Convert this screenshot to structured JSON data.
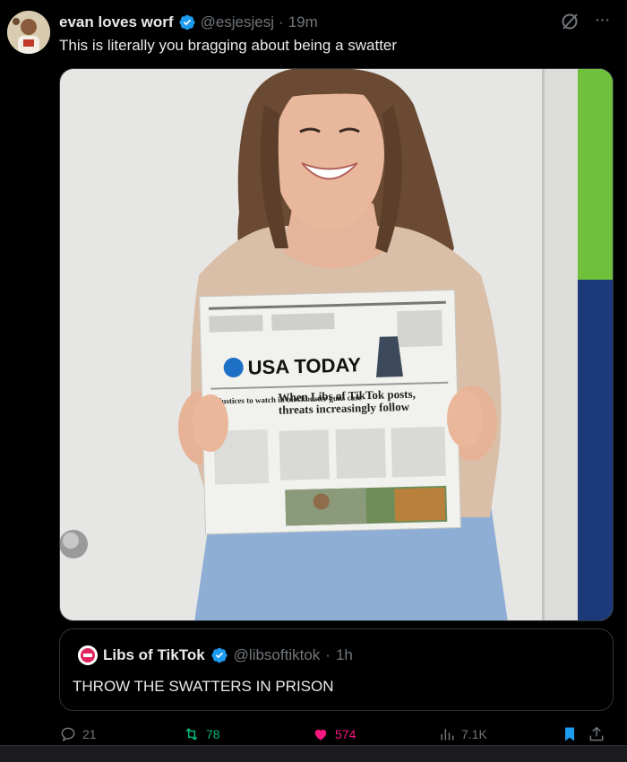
{
  "tweet": {
    "display_name": "evan loves worf",
    "handle": "@esjesjesj",
    "separator": "·",
    "time": "19m",
    "text": "This is literally you bragging about being a swatter"
  },
  "newspaper": {
    "masthead": "USA TODAY",
    "headline": "When Libs of TikTok posts, threats increasingly follow",
    "sidebar_headline": "3 justices to watch in blockbuster guns case"
  },
  "quote": {
    "display_name": "Libs of TikTok",
    "handle": "@libsoftiktok",
    "separator": "·",
    "time": "1h",
    "text": "THROW THE SWATTERS IN PRISON"
  },
  "actions": {
    "replies": "21",
    "reposts": "78",
    "likes": "574",
    "views": "7.1K"
  },
  "colors": {
    "background": "#000000",
    "verified": "#1d9bf0",
    "repost": "#00ba7c",
    "like": "#f91880",
    "bookmark": "#1d9bf0",
    "muted": "#71767b"
  },
  "icons": [
    "verified-badge-icon",
    "grok-icon",
    "more-icon",
    "reply-icon",
    "repost-icon",
    "heart-icon",
    "views-icon",
    "bookmark-icon",
    "share-icon"
  ]
}
